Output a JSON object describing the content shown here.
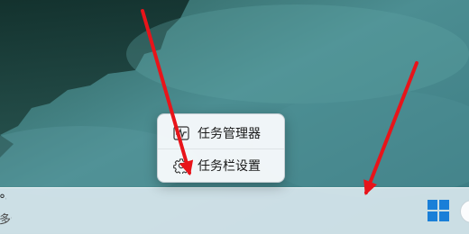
{
  "context_menu": {
    "items": [
      {
        "label": "任务管理器",
        "icon": "task-manager-icon"
      },
      {
        "label": "任务栏设置",
        "icon": "gear-icon"
      }
    ]
  },
  "taskbar": {
    "weather_temp": "°C",
    "weather_condition": "多云",
    "start_icon": "windows-logo-icon"
  },
  "colors": {
    "arrow": "#e8141a",
    "taskbar_bg": "#d6e5ec",
    "menu_bg": "#f6f9fb",
    "windows_blue": "#1a7fd8"
  }
}
